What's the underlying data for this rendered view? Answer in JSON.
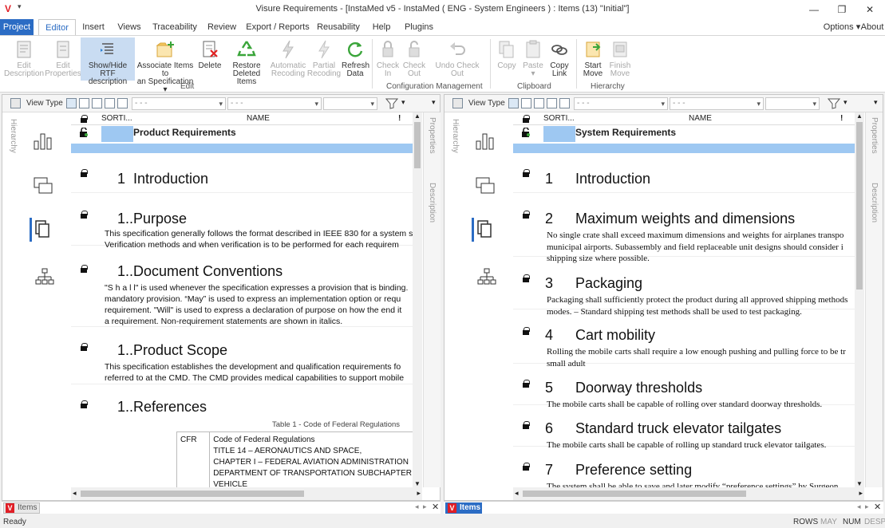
{
  "window": {
    "title": "Visure Requirements - [InstaMed v5 - InstaMed ( ENG - System Engineers ) : Items (13) \"Initial\"]",
    "minimize": "—",
    "maximize": "❐",
    "close": "✕"
  },
  "menu": {
    "tabs": [
      "Project",
      "Editor",
      "Insert",
      "Views",
      "Traceability",
      "Review",
      "Export / Reports",
      "Reusability",
      "Help",
      "Plugins"
    ],
    "options": "Options",
    "about": "About"
  },
  "ribbon": {
    "buttons": [
      {
        "label1": "Edit",
        "label2": "Description"
      },
      {
        "label1": "Edit",
        "label2": "Properties"
      },
      {
        "label1": "Show/Hide RTF",
        "label2": "description"
      },
      {
        "label1": "Associate Items to",
        "label2": "an Specification ▾"
      },
      {
        "label1": "Delete",
        "label2": ""
      },
      {
        "label1": "Restore",
        "label2": "Deleted Items"
      },
      {
        "label1": "Automatic",
        "label2": "Recoding"
      },
      {
        "label1": "Partial",
        "label2": "Recoding"
      },
      {
        "label1": "Refresh",
        "label2": "Data"
      },
      {
        "label1": "Check",
        "label2": "In"
      },
      {
        "label1": "Check",
        "label2": "Out"
      },
      {
        "label1": "Undo Check Out",
        "label2": ""
      },
      {
        "label1": "Copy",
        "label2": ""
      },
      {
        "label1": "Paste",
        "label2": "▾"
      },
      {
        "label1": "Copy",
        "label2": "Link"
      },
      {
        "label1": "Start",
        "label2": "Move"
      },
      {
        "label1": "Finish",
        "label2": "Move"
      }
    ],
    "groups": [
      "Edit",
      "Configuration Management",
      "Clipboard",
      "Hierarchy"
    ]
  },
  "left_pane": {
    "view_type": "View Type",
    "combo1": "- - -",
    "combo2": "- - -",
    "side_labels": [
      "Hierarchy",
      "Properties",
      "Description"
    ],
    "col_sort": "SORTI...",
    "col_name": "NAME",
    "col_flag": "!",
    "spec_title": "Product Requirements",
    "sections": [
      {
        "num": "1",
        "title": "Introduction",
        "text": []
      },
      {
        "num": "1..",
        "title": "Purpose",
        "text": [
          "This specification generally follows the format described in IEEE 830 for a system s",
          "Verification methods and when verification is to be performed for each requirem"
        ]
      },
      {
        "num": "1..",
        "title": "Document Conventions",
        "text": [
          "\"S h a l l\" is used whenever the specification expresses a provision that is binding.",
          "mandatory provision. “May” is used to express an implementation option or requ",
          "requirement.  \"Will\" is used to express a declaration of purpose on how the end it",
          "a requirement.  Non-requirement statements are shown in italics."
        ]
      },
      {
        "num": "1..",
        "title": "Product Scope",
        "text": [
          "This specification establishes the development and qualification requirements fo",
          "referred to at the CMD.  The CMD provides medical capabilities to support mobile"
        ]
      },
      {
        "num": "1..",
        "title": "References",
        "text": []
      }
    ],
    "table_caption": "Table 1 - Code of Federal Regulations",
    "table": {
      "key": "CFR",
      "lines": [
        "Code of Federal Regulations",
        "TITLE 14 – AERONAUTICS AND SPACE,",
        "CHAPTER I – FEDERAL AVIATION ADMINISTRATION",
        "DEPARTMENT OF TRANSPORTATION SUBCHAPTER",
        "VEHICLE"
      ]
    },
    "bottom_tab": "Items"
  },
  "right_pane": {
    "view_type": "View Type",
    "combo1": "- - -",
    "combo2": "- - -",
    "side_labels": [
      "Hierarchy",
      "Properties",
      "Description"
    ],
    "col_sort": "SORTI...",
    "col_name": "NAME",
    "col_flag": "!",
    "spec_title": "System Requirements",
    "sections": [
      {
        "num": "1",
        "title": "Introduction",
        "text": []
      },
      {
        "num": "2",
        "title": "Maximum weights and dimensions",
        "text": [
          "No single crate shall exceed maximum dimensions and weights for airplanes transpo",
          "municipal airports.  Subassembly and field replaceable unit designs should consider i",
          "shipping size where possible."
        ]
      },
      {
        "num": "3",
        "title": "Packaging",
        "text": [
          "Packaging shall sufficiently protect the product during all approved shipping methods",
          "modes. – Standard shipping test methods shall be used to test packaging."
        ]
      },
      {
        "num": "4",
        "title": "Cart mobility",
        "text": [
          "Rolling the mobile carts shall require a low enough pushing and pulling force to be tr",
          "small adult"
        ]
      },
      {
        "num": "5",
        "title": "Doorway thresholds",
        "text": [
          "The mobile carts shall be capable of rolling over standard doorway thresholds."
        ]
      },
      {
        "num": "6",
        "title": "Standard truck elevator tailgates",
        "text": [
          "The mobile carts shall be capable of rolling up standard truck elevator tailgates."
        ]
      },
      {
        "num": "7",
        "title": "Preference setting",
        "text": [
          "The system shall be able to save and later modify “preference settings” by Surgeon"
        ]
      }
    ],
    "bottom_tab": "Items"
  },
  "status": {
    "left": "Ready",
    "indicators": [
      "ROWS",
      "MAY",
      "NUM",
      "DESP"
    ]
  }
}
